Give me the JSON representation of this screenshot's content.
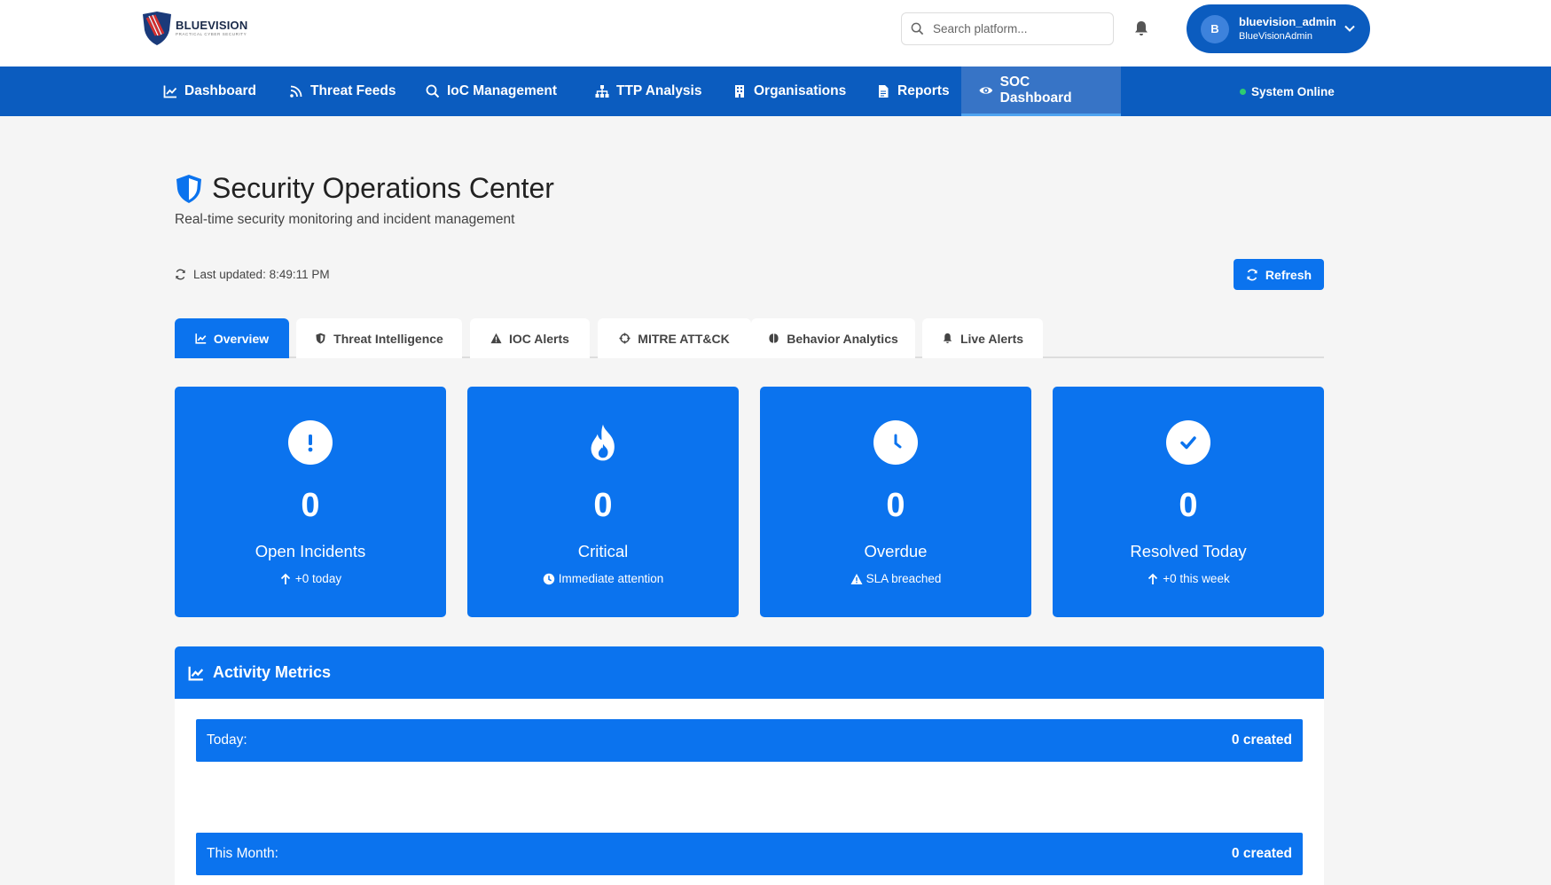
{
  "header": {
    "brand_name": "BLUEVISION",
    "brand_tagline": "PRACTICAL CYBER SECURITY",
    "search_placeholder": "Search platform...",
    "user": {
      "initial": "B",
      "username": "bluevision_admin",
      "organisation": "BlueVisionAdmin"
    }
  },
  "nav": {
    "items": [
      {
        "label": "Dashboard",
        "icon": "chart-line-icon"
      },
      {
        "label": "Threat Feeds",
        "icon": "rss-icon"
      },
      {
        "label": "IoC Management",
        "icon": "search-icon"
      },
      {
        "label": "TTP Analysis",
        "icon": "sitemap-icon"
      },
      {
        "label": "Organisations",
        "icon": "building-icon"
      },
      {
        "label": "Reports",
        "icon": "file-icon"
      },
      {
        "label": "SOC Dashboard",
        "icon": "eye-icon",
        "active": true
      }
    ],
    "status": "System Online",
    "status_color": "#2ecc71"
  },
  "page": {
    "title": "Security Operations Center",
    "subtitle": "Real-time security monitoring and incident management",
    "last_updated": "Last updated: 8:49:11 PM",
    "refresh_label": "Refresh"
  },
  "tabs": [
    {
      "label": "Overview",
      "icon": "chart-line-icon",
      "active": true
    },
    {
      "label": "Threat Intelligence",
      "icon": "shield-icon"
    },
    {
      "label": "IOC Alerts",
      "icon": "warning-icon"
    },
    {
      "label": "MITRE ATT&CK",
      "icon": "crosshairs-icon"
    },
    {
      "label": "Behavior Analytics",
      "icon": "brain-icon"
    },
    {
      "label": "Live Alerts",
      "icon": "bell-icon"
    }
  ],
  "stats": [
    {
      "value": "0",
      "label": "Open Incidents",
      "sub": "+0 today",
      "icon": "exclamation-icon",
      "sub_icon": "arrow-up-icon"
    },
    {
      "value": "0",
      "label": "Critical",
      "sub": "Immediate attention",
      "icon": "fire-icon",
      "sub_icon": "clock-icon"
    },
    {
      "value": "0",
      "label": "Overdue",
      "sub": "SLA breached",
      "icon": "clock-icon",
      "sub_icon": "warning-icon"
    },
    {
      "value": "0",
      "label": "Resolved Today",
      "sub": "+0 this week",
      "icon": "check-icon",
      "sub_icon": "arrow-up-icon"
    }
  ],
  "metrics": {
    "title": "Activity Metrics",
    "rows": [
      {
        "label": "Today:",
        "value": "0 created"
      },
      {
        "label": "This Month:",
        "value": "0 created"
      }
    ]
  },
  "colors": {
    "nav_blue": "#0b5cbf",
    "accent_blue": "#0b73ee",
    "active_nav": "#3774c6"
  }
}
